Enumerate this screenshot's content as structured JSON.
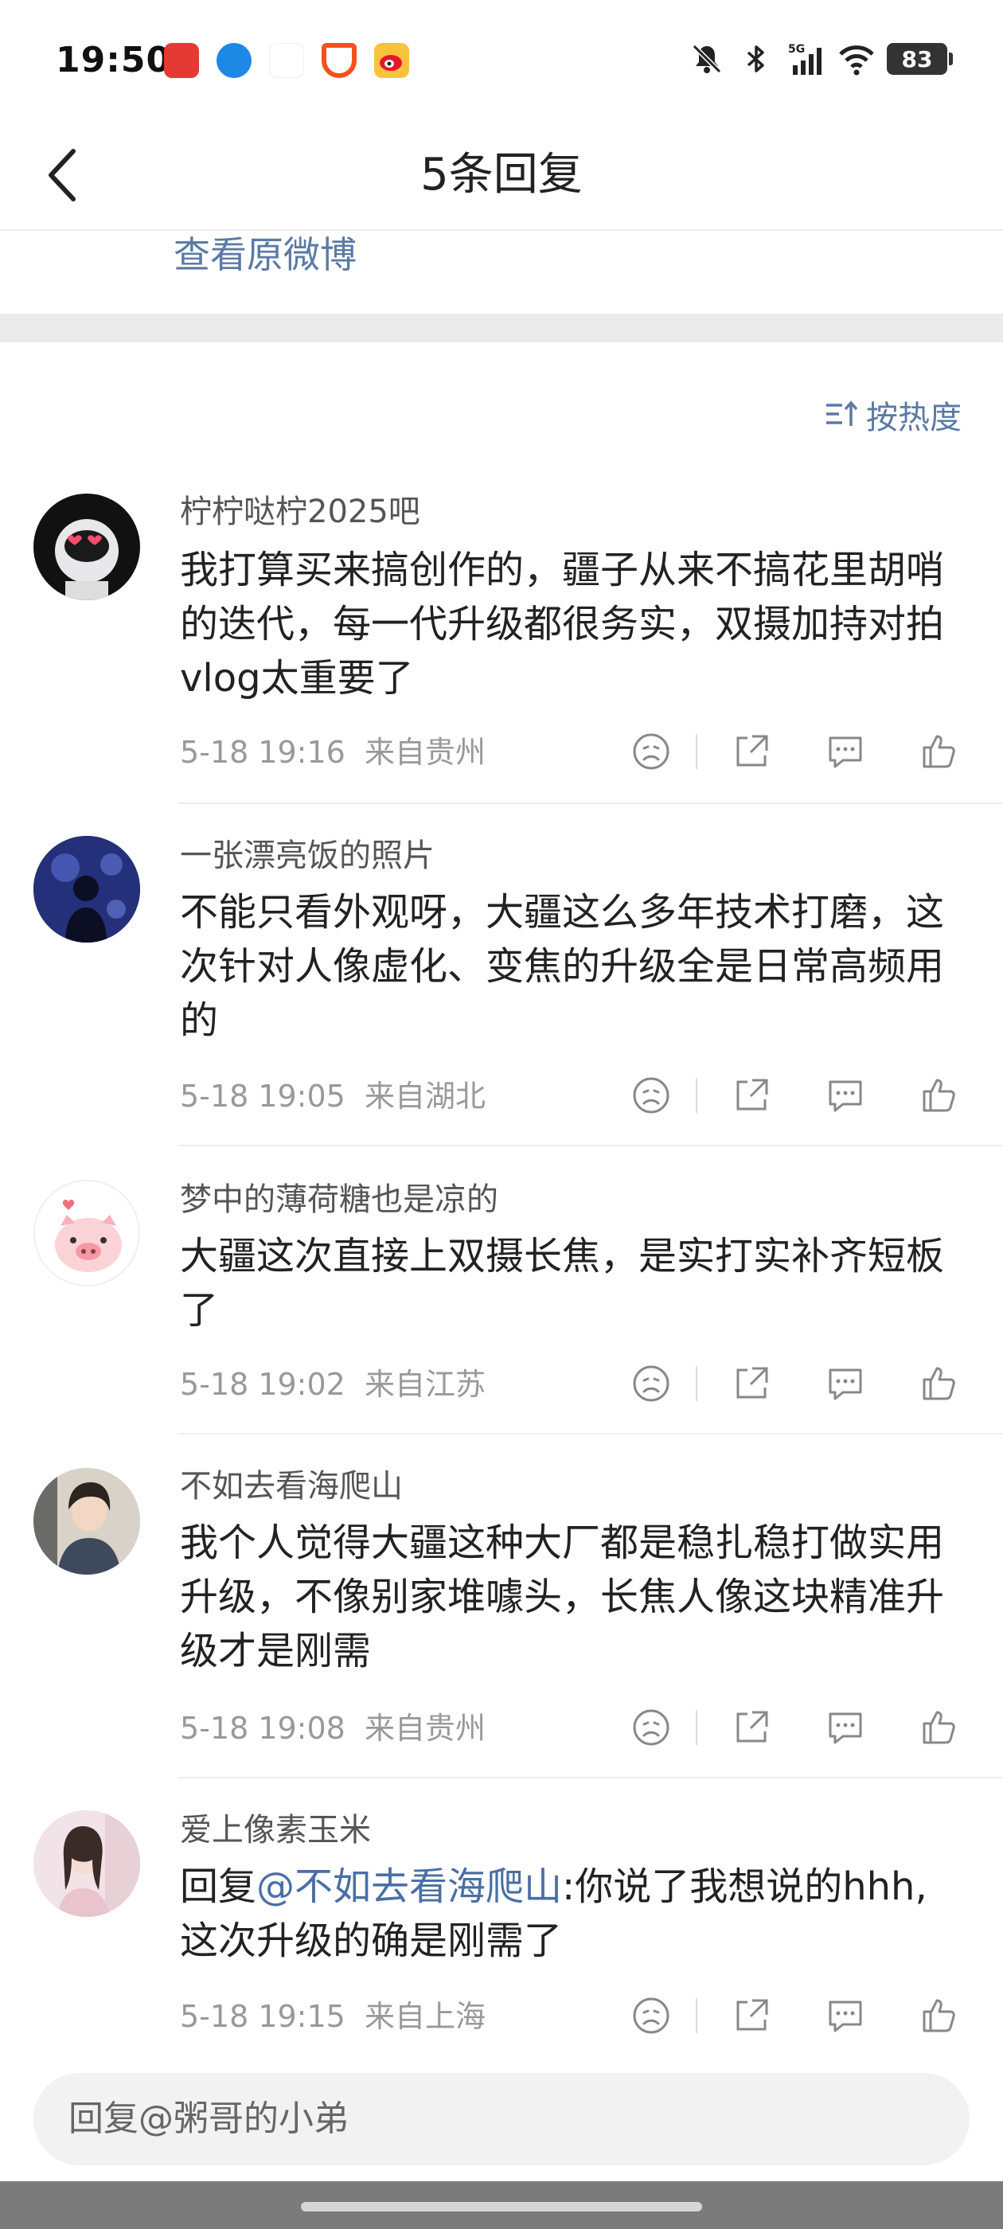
{
  "status_bar": {
    "time": "19:50",
    "battery": "83",
    "notification_icons": [
      "app-red-icon",
      "app-blue-icon",
      "app-white-icon",
      "app-orange-icon",
      "weibo-icon"
    ],
    "system_icons": [
      "mute-bell-icon",
      "bluetooth-icon",
      "5g-signal-icon",
      "wifi-icon"
    ]
  },
  "nav": {
    "title": "5条回复"
  },
  "view_original": "查看原微博",
  "sort": {
    "label": "按热度"
  },
  "comments": [
    {
      "user": "柠柠哒柠2025吧",
      "text": "我打算买来搞创作的，疆子从来不搞花里胡哨的迭代，每一代升级都很务实，双摄加持对拍vlog太重要了",
      "time": "5-18 19:16",
      "location": "来自贵州"
    },
    {
      "user": "一张漂亮饭的照片",
      "text": "不能只看外观呀，大疆这么多年技术打磨，这次针对人像虚化、变焦的升级全是日常高频用的",
      "time": "5-18 19:05",
      "location": "来自湖北"
    },
    {
      "user": "梦中的薄荷糖也是凉的",
      "text": "大疆这次直接上双摄长焦，是实打实补齐短板了",
      "time": "5-18 19:02",
      "location": "来自江苏"
    },
    {
      "user": "不如去看海爬山",
      "text": "我个人觉得大疆这种大厂都是稳扎稳打做实用升级，不像别家堆噱头，长焦人像这块精准升级才是刚需",
      "time": "5-18 19:08",
      "location": "来自贵州"
    },
    {
      "user": "爱上像素玉米",
      "reply_prefix": "回复",
      "mention": "@不如去看海爬山",
      "text": ":你说了我想说的hhh,这次升级的确是刚需了",
      "time": "5-18 19:15",
      "location": "来自上海"
    }
  ],
  "reply_input": {
    "placeholder": "回复@粥哥的小弟"
  },
  "colors": {
    "link_blue": "#5a7aa6",
    "mention_blue": "#4a6fa5",
    "meta_gray": "#999999",
    "separator_band": "#ebebeb"
  }
}
